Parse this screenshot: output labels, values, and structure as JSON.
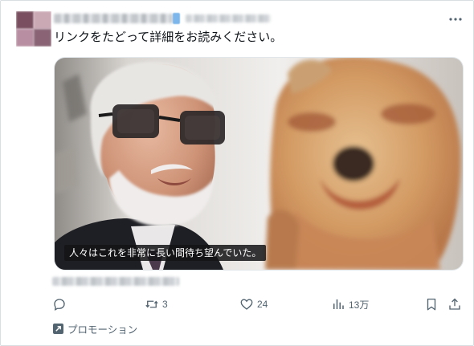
{
  "tweet": {
    "text": "リンクをたどって詳細をお読みください。",
    "media": {
      "caption": "人々はこれを非常に長い間待ち望んでいた。"
    }
  },
  "actions": {
    "reply": {
      "icon": "reply-icon",
      "count": ""
    },
    "retweet": {
      "icon": "retweet-icon",
      "count": "3"
    },
    "like": {
      "icon": "heart-icon",
      "count": "24"
    },
    "views": {
      "icon": "views-icon",
      "count": "13万"
    },
    "bookmark": {
      "icon": "bookmark-icon"
    },
    "share": {
      "icon": "share-icon"
    }
  },
  "promo": {
    "icon": "promoted-arrow-icon",
    "label": "プロモーション"
  },
  "colors": {
    "text": "#0f1419",
    "secondary": "#536471",
    "border": "#e1e6ea",
    "caption_bg": "#141416"
  }
}
